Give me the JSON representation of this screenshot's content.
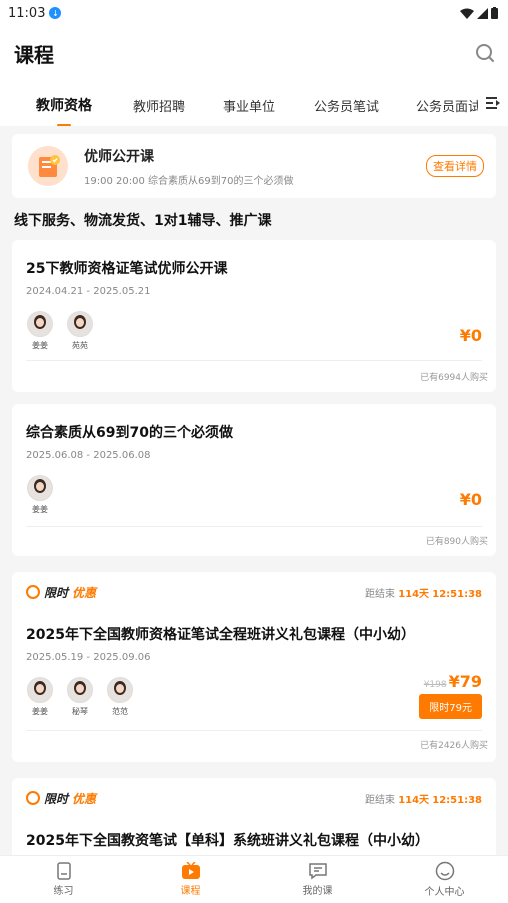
{
  "status": {
    "time": "11:03"
  },
  "header": {
    "title": "课程"
  },
  "tabs": [
    {
      "label": "教师资格",
      "active": true
    },
    {
      "label": "教师招聘",
      "active": false
    },
    {
      "label": "事业单位",
      "active": false
    },
    {
      "label": "公务员笔试",
      "active": false
    },
    {
      "label": "公务员面试",
      "active": false
    }
  ],
  "promo": {
    "title": "优师公开课",
    "subtitle": "19:00 20:00 综合素质从69到70的三个必须做",
    "button": "查看详情"
  },
  "section_banner": "线下服务、物流发货、1对1辅导、推广课",
  "courses": [
    {
      "title": "25下教师资格证笔试优师公开课",
      "date": "2024.04.21 - 2025.05.21",
      "teachers": [
        "姜姜",
        "苑苑"
      ],
      "price": "¥0",
      "buyers": "已有6994人购买"
    },
    {
      "title": "综合素质从69到70的三个必须做",
      "date": "2025.06.08 - 2025.06.08",
      "teachers": [
        "姜姜"
      ],
      "price": "¥0",
      "buyers": "已有890人购买"
    },
    {
      "badge_w1": "限时",
      "badge_w2": "优惠",
      "countdown_label": "距结束",
      "countdown_days": "114天",
      "countdown_time": "12:51:38",
      "title": "2025年下全国教师资格证笔试全程班讲义礼包课程（中小幼）",
      "date": "2025.05.19 - 2025.09.06",
      "teachers": [
        "姜姜",
        "秘琴",
        "范范"
      ],
      "old_price": "¥198",
      "price": "¥79",
      "deal_button": "限时79元",
      "buyers": "已有2426人购买"
    },
    {
      "badge_w1": "限时",
      "badge_w2": "优惠",
      "countdown_label": "距结束",
      "countdown_days": "114天",
      "countdown_time": "12:51:38",
      "title": "2025年下全国教资笔试【单科】系统班讲义礼包课程（中小幼）"
    }
  ],
  "bottom_nav": [
    {
      "label": "练习",
      "icon": "practice-icon",
      "active": false
    },
    {
      "label": "课程",
      "icon": "course-icon",
      "active": true
    },
    {
      "label": "我的课",
      "icon": "my-course-icon",
      "active": false
    },
    {
      "label": "个人中心",
      "icon": "profile-icon",
      "active": false
    }
  ],
  "colors": {
    "accent": "#ff7a00",
    "background": "#f5f5f5"
  }
}
